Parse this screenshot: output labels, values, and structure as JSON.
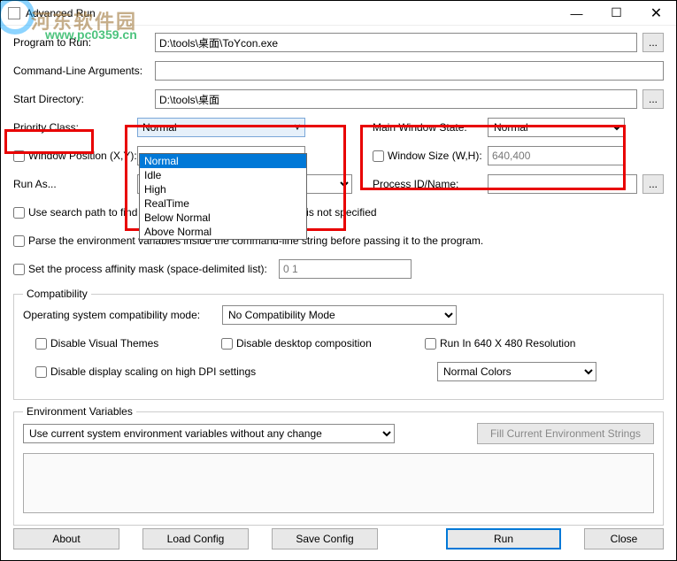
{
  "window": {
    "title": "Advanced Run"
  },
  "watermark": {
    "text": "河东软件园",
    "url": "www.pc0359.cn"
  },
  "labels": {
    "program_to_run": "Program to Run:",
    "cmdline_args": "Command-Line Arguments:",
    "start_dir": "Start Directory:",
    "priority_class": "Priority Class:",
    "main_window_state": "Main Window State:",
    "window_position": "Window Position (X,Y):",
    "window_size": "Window Size (W,H):",
    "run_as": "Run As...",
    "process_id_name": "Process ID/Name:",
    "use_search_path": "Use search path to find the program location if the full path is not specified",
    "parse_env": "Parse the environment variables inside the command-line string before passing it to the program.",
    "set_affinity": "Set the process affinity mask (space-delimited list):",
    "compat_legend": "Compatibility",
    "compat_mode": "Operating system compatibility mode:",
    "disable_visual_themes": "Disable Visual Themes",
    "disable_desktop_comp": "Disable desktop composition",
    "run_640x480": "Run In 640 X 480 Resolution",
    "disable_dpi_scaling": "Disable display scaling on high DPI settings",
    "env_legend": "Environment Variables",
    "fill_env": "Fill Current Environment Strings"
  },
  "values": {
    "program_to_run": "D:\\tools\\桌面\\ToYcon.exe",
    "cmdline_args": "",
    "start_dir": "D:\\tools\\桌面",
    "priority_class": "Normal",
    "main_window_state": "Normal",
    "window_position": "",
    "window_size": "640,400",
    "run_as_visible": "n",
    "affinity": "0 1",
    "compat_mode": "No Compatibility Mode",
    "colors": "Normal Colors",
    "env_mode": "Use current system environment variables without any change"
  },
  "priority_options": [
    "Normal",
    "Idle",
    "High",
    "RealTime",
    "Below Normal",
    "Above Normal"
  ],
  "buttons": {
    "about": "About",
    "load_config": "Load Config",
    "save_config": "Save Config",
    "run": "Run",
    "close": "Close",
    "browse": "..."
  }
}
